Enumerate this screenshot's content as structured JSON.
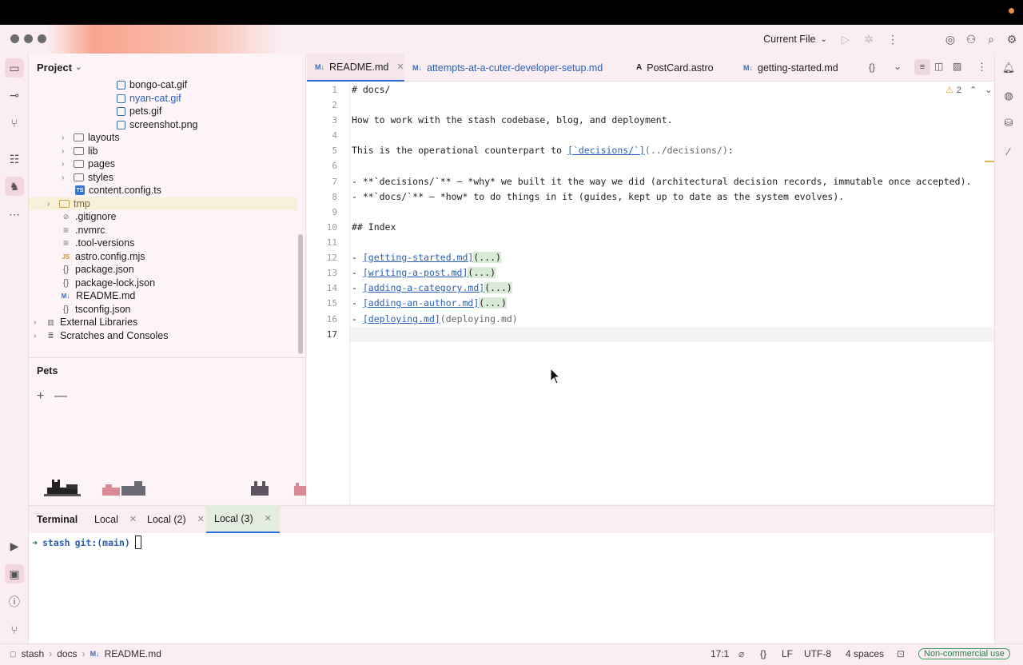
{
  "titlebar": {
    "run_config": "Current File"
  },
  "project": {
    "title": "Project",
    "tree": [
      {
        "label": "bongo-cat.gif",
        "type": "gif",
        "indent": 0
      },
      {
        "label": "nyan-cat.gif",
        "type": "gif",
        "highlight": true
      },
      {
        "label": "pets.gif",
        "type": "gif"
      },
      {
        "label": "screenshot.png",
        "type": "gif"
      },
      {
        "label": "layouts",
        "type": "folder"
      },
      {
        "label": "lib",
        "type": "folder"
      },
      {
        "label": "pages",
        "type": "folder"
      },
      {
        "label": "styles",
        "type": "folder"
      },
      {
        "label": "content.config.ts",
        "type": "ts"
      },
      {
        "label": "tmp",
        "type": "folder"
      },
      {
        "label": ".gitignore",
        "type": "ignore"
      },
      {
        "label": ".nvmrc",
        "type": "lines"
      },
      {
        "label": ".tool-versions",
        "type": "lines"
      },
      {
        "label": "astro.config.mjs",
        "type": "js"
      },
      {
        "label": "package.json",
        "type": "json"
      },
      {
        "label": "package-lock.json",
        "type": "json"
      },
      {
        "label": "README.md",
        "type": "md"
      },
      {
        "label": "tsconfig.json",
        "type": "json"
      },
      {
        "label": "External Libraries",
        "type": "lib"
      },
      {
        "label": "Scratches and Consoles",
        "type": "scratch"
      }
    ]
  },
  "pets": {
    "title": "Pets",
    "add": "+",
    "remove": "—"
  },
  "editor": {
    "tabs": [
      {
        "label": "README.md",
        "badge": "M↓"
      },
      {
        "label": "attempts-at-a-cuter-developer-setup.md",
        "badge": "M↓"
      },
      {
        "label": "PostCard.astro",
        "badge": "A"
      },
      {
        "label": "getting-started.md",
        "badge": "M↓"
      }
    ],
    "warnings": "2",
    "line_numbers": [
      "1",
      "2",
      "3",
      "4",
      "5",
      "6",
      "7",
      "8",
      "9",
      "10",
      "11",
      "12",
      "13",
      "14",
      "15",
      "16",
      "17"
    ],
    "lines": {
      "l1": "# docs/",
      "l3": "How to work with the stash codebase, blog, and deployment.",
      "l5a": "This is the operational counterpart to ",
      "l5b": "[`decisions/`]",
      "l5c": "(../decisions/)",
      "l5d": ":",
      "l7a": "- **`decisions/`** — *why* we built it the way we did (architectural decision records, immutable once accepted).",
      "l8a": "- **`docs/`** — *how* to do things in it (guides, kept up to date as the system evolves).",
      "l10": "## Index",
      "l12a": "- ",
      "l12b": "[getting-started.md]",
      "l12c": "(...)",
      "l13b": "[writing-a-post.md]",
      "l13c": "(...)",
      "l14b": "[adding-a-category.md]",
      "l14c": "(...)",
      "l15b": "[adding-an-author.md]",
      "l15c": "(...)",
      "l16b": "[deploying.md]",
      "l16c": "(deploying.md)"
    }
  },
  "terminal": {
    "title": "Terminal",
    "tabs": [
      "Local",
      "Local (2)",
      "Local (3)"
    ],
    "prompt_arrow": "➜",
    "prompt_dir": "stash",
    "prompt_git": "git:(main)"
  },
  "status": {
    "crumbs": [
      "stash",
      "docs",
      "README.md"
    ],
    "position": "17:1",
    "braces": "{}",
    "line_ending": "LF",
    "encoding": "UTF-8",
    "indent": "4 spaces",
    "license": "Non-commercial use"
  },
  "colors": {
    "accent": "#2e6bd6",
    "background": "#fbeef2",
    "license_green": "#3d9a5d"
  }
}
